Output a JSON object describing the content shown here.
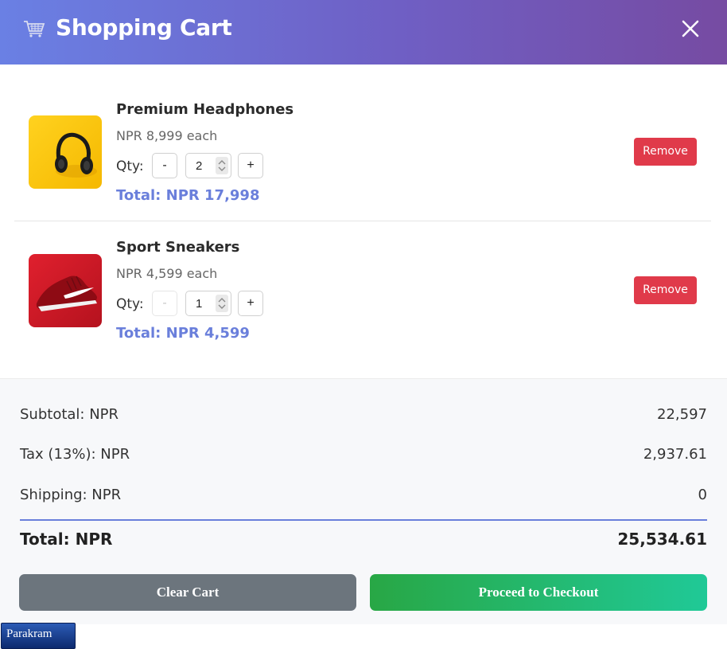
{
  "header": {
    "title": "Shopping Cart",
    "cart_icon": "shopping-cart-icon",
    "close_icon": "close-icon"
  },
  "items": [
    {
      "name": "Premium Headphones",
      "unit_price": "NPR 8,999 each",
      "qty_label": "Qty:",
      "minus": "-",
      "quantity": "2",
      "plus": "+",
      "total": "Total: NPR 17,998",
      "remove_label": "Remove",
      "image": "headphones-image",
      "minus_disabled": false
    },
    {
      "name": "Sport Sneakers",
      "unit_price": "NPR 4,599 each",
      "qty_label": "Qty:",
      "minus": "-",
      "quantity": "1",
      "plus": "+",
      "total": "Total: NPR 4,599",
      "remove_label": "Remove",
      "image": "sneakers-image",
      "minus_disabled": true
    }
  ],
  "summary": {
    "subtotal_label": "Subtotal: NPR",
    "subtotal_value": "22,597",
    "tax_label": "Tax (13%): NPR",
    "tax_value": "2,937.61",
    "shipping_label": "Shipping: NPR",
    "shipping_value": "0",
    "total_label": "Total: NPR",
    "total_value": "25,534.61"
  },
  "actions": {
    "clear_label": "Clear Cart",
    "checkout_label": "Proceed to Checkout"
  },
  "footer": {
    "tag_label": "Parakram"
  },
  "colors": {
    "header_gradient_start": "#6a80e4",
    "header_gradient_end": "#764ba2",
    "accent": "#6a7fdb",
    "remove": "#e03a4a",
    "clear": "#6c757d",
    "checkout_start": "#28a745",
    "checkout_end": "#20c997"
  }
}
